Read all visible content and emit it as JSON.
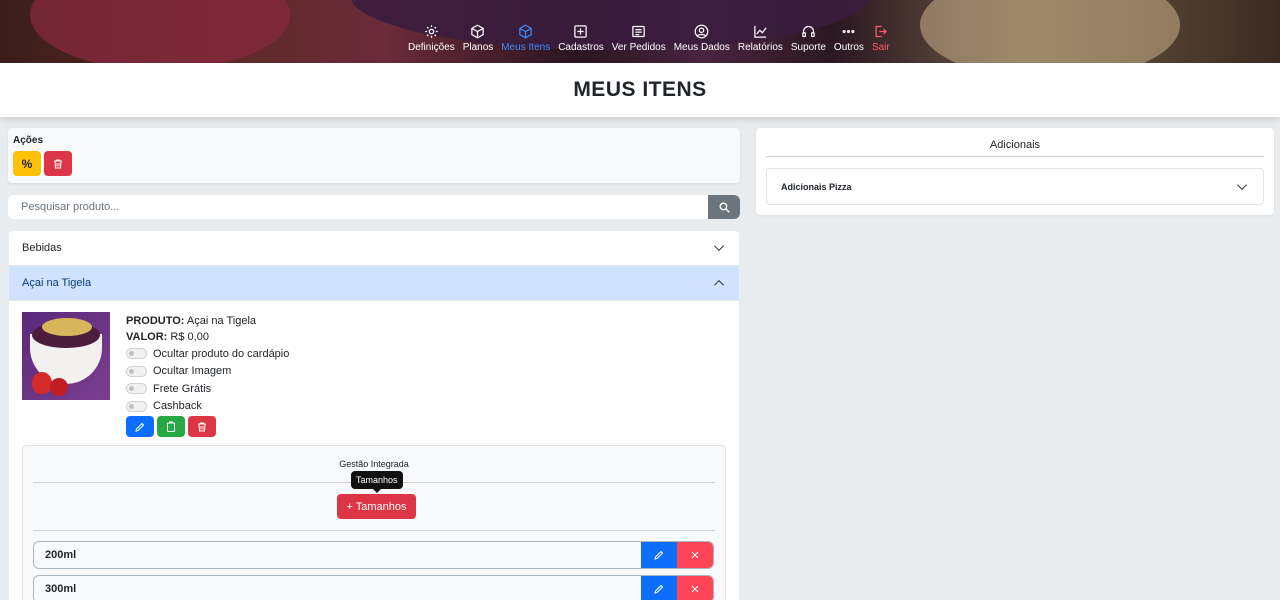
{
  "nav": [
    {
      "label": "Definições",
      "icon": "gear-icon"
    },
    {
      "label": "Planos",
      "icon": "box-icon"
    },
    {
      "label": "Meus Itens",
      "icon": "box-icon"
    },
    {
      "label": "Cadastros",
      "icon": "plus-square-icon"
    },
    {
      "label": "Ver Pedidos",
      "icon": "list-icon"
    },
    {
      "label": "Meus Dados",
      "icon": "user-circle-icon"
    },
    {
      "label": "Relatórios",
      "icon": "chart-line-icon"
    },
    {
      "label": "Suporte",
      "icon": "headset-icon"
    },
    {
      "label": "Outros",
      "icon": "ellipsis-icon"
    },
    {
      "label": "Sair",
      "icon": "logout-icon"
    }
  ],
  "colors": {
    "active_nav": "#3f8cff",
    "logout": "#ff5a6a",
    "primary": "#0d6efd",
    "danger": "#dc3545",
    "warning": "#ffc107",
    "success": "#28a745"
  },
  "page_title": "MEUS ITENS",
  "acoes": {
    "label": "Ações",
    "percent_label": "%"
  },
  "search": {
    "placeholder": "Pesquisar produto..."
  },
  "categories": [
    {
      "label": "Bebidas"
    },
    {
      "label": "Açai na Tigela"
    }
  ],
  "product": {
    "produto_label": "PRODUTO:",
    "produto_value": "Açai na Tigela",
    "valor_label": "VALOR:",
    "valor_value": "R$ 0,00",
    "toggles": [
      {
        "label": "Ocultar produto do cardápio"
      },
      {
        "label": "Ocultar Imagem"
      },
      {
        "label": "Frete Grátis"
      },
      {
        "label": "Cashback"
      }
    ]
  },
  "gestao": {
    "title": "Gestão Integrada",
    "tooltip": "Tamanhos",
    "add_button": "+ Tamanhos",
    "sizes": [
      {
        "label": "200ml"
      },
      {
        "label": "300ml"
      }
    ]
  },
  "adicionais": {
    "title": "Adicionais",
    "items": [
      {
        "label": "Adicionais Pizza"
      }
    ]
  }
}
